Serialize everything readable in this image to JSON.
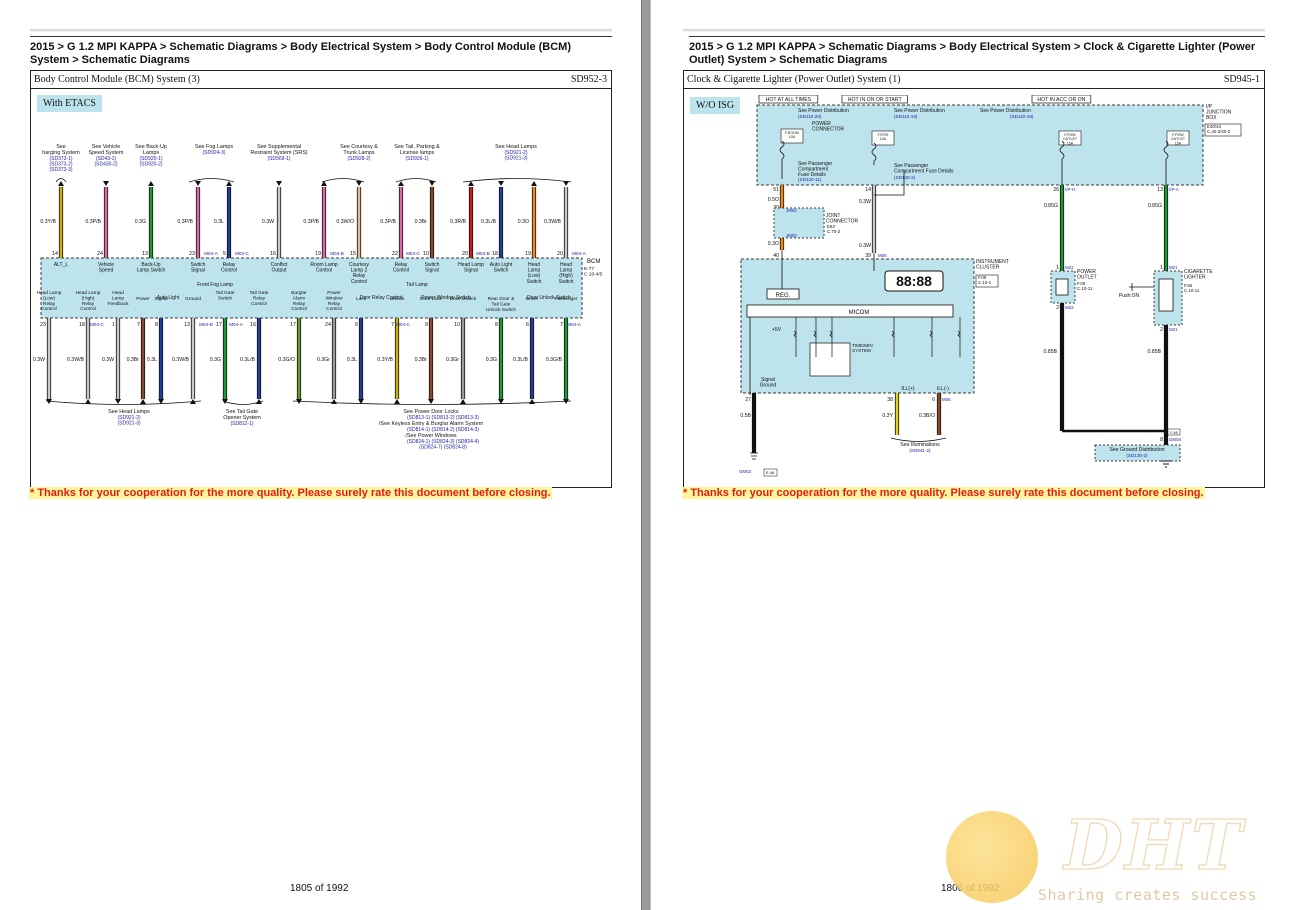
{
  "left_page": {
    "breadcrumb": "2015 > G 1.2 MPI KAPPA > Schematic Diagrams > Body Electrical System > Body Control Module (BCM) System > Schematic Diagrams",
    "sheet_title": "Body Control Module (BCM) System (3)",
    "sheet_code": "SD952-3",
    "variant_label": "With ETACS",
    "notice": "* Thanks for your cooperation for the more quality. Please surely rate this document before closing.",
    "page_number": "1805 of 1992",
    "top_refs": [
      {
        "title": "See\nharging System",
        "codes": "(SD373-1)\n(SD373-2)\n(SD373-3)"
      },
      {
        "title": "See Vehicle\nSpeed System",
        "codes": "(SD43-1)\n(SD430-2)"
      },
      {
        "title": "See Back-Up\nLamps",
        "codes": "(SD920-1)\n(SD920-2)"
      },
      {
        "title": "See Fog Lamps",
        "codes": "(SD924-3)"
      },
      {
        "title": "See Supplemental\nRestraint System (SRS)",
        "codes": "(SD569-1)"
      },
      {
        "title": "See Courtesy &\nTrunk Lamps",
        "codes": "(SD928-2)"
      },
      {
        "title": "See Tail, Parking &\nLicense lamps",
        "codes": "(SD926-1)"
      },
      {
        "title": "See Head Lamps",
        "codes": "(SD921-2)\n(SD921-3)"
      }
    ],
    "top_wires": [
      {
        "gauge": "0.3Y/B",
        "pin": "14",
        "color": "#c8b40a"
      },
      {
        "gauge": "0.3P/B",
        "pin": "24",
        "color": "#d96aa8"
      },
      {
        "gauge": "0.3G",
        "pin": "13",
        "color": "#1f9a3a"
      },
      {
        "gauge": "0.3P/B",
        "pin": "23",
        "color": "#d96aa8"
      },
      {
        "gauge": "0.3L",
        "pin": "5",
        "color": "#1f3f9a"
      },
      {
        "gauge": "0.3W",
        "pin": "16",
        "color": "#c9c9c9"
      },
      {
        "gauge": "0.3P/B",
        "pin": "19",
        "color": "#d96aa8"
      },
      {
        "gauge": "0.3W/O",
        "pin": "15",
        "color": "#e9b894"
      },
      {
        "gauge": "0.3P/B",
        "pin": "22",
        "color": "#d96aa8"
      },
      {
        "gauge": "0.3Br",
        "pin": "10",
        "color": "#8a4a2a"
      },
      {
        "gauge": "0.3R/B",
        "pin": "20",
        "color": "#c71e1e"
      },
      {
        "gauge": "0.3L/B",
        "pin": "18",
        "color": "#1f3f9a"
      },
      {
        "gauge": "0.3O",
        "pin": "19",
        "color": "#ef8b1e"
      },
      {
        "gauge": "0.3W/B",
        "pin": "20",
        "color": "#c9c9c9"
      }
    ],
    "top_connectors": [
      "M04-A",
      "M04-C",
      "M04-B",
      "M04-C",
      "M04-B",
      "M04-A"
    ],
    "bcm_label": "BCM",
    "bcm_ref": "E-77\nC.10-4/5",
    "bcm_top_labels": [
      "ALT_L",
      "Vehicle\nSpeed",
      "Back-Up\nLamp Switch",
      "Switch\nSignal",
      "Relay\nControl",
      "Conflict\nOutput",
      "Room Lamp\nControl",
      "Courtesy\nLamp 2\nRelay\nControl",
      "Relay\nControl",
      "Switch\nSignal",
      "Head Lamp\nSignal",
      "Auto Light\nSwitch",
      "Head\nLamp\n(Low)\nSwitch",
      "Head\nLamp\n(High)\nSwitch"
    ],
    "bcm_group_top": [
      "Front Fog Lamp",
      "Tail Lamp"
    ],
    "bcm_bottom_labels": [
      "Head Lamp\n(Low)\nRelay\nControl",
      "Head Lamp\n(High)\nRelay\nControl",
      "Head\nLamp\nFeedback",
      "Power",
      "Signal",
      "Ground",
      "Tail Gate\nSwitch",
      "Tail Gate\nRelay\nControl",
      "Burglar\nAlarm\nRelay\nControl",
      "Power\nWindow\nRelay\nControl",
      "Lock",
      "Unlock",
      "Door Lock",
      "Door Unlock",
      "Rear Door &\nTail Gate\nUnlock Switch",
      "Driver",
      "Passenger"
    ],
    "bcm_group_bottom": [
      "Auto Light",
      "Door Relay Control",
      "Power Window Switch",
      "Door Unlock Switch"
    ],
    "bottom_wires": [
      {
        "gauge": "0.3W",
        "pin": "23",
        "color": "#c9c9c9"
      },
      {
        "gauge": "0.3W/B",
        "pin": "18",
        "color": "#c9c9c9"
      },
      {
        "gauge": "0.3W",
        "pin": "1",
        "color": "#c9c9c9"
      },
      {
        "gauge": "0.3Br",
        "pin": "7",
        "color": "#8a4a2a"
      },
      {
        "gauge": "0.3L",
        "pin": "8",
        "color": "#1f3f9a"
      },
      {
        "gauge": "0.3W/B",
        "pin": "13",
        "color": "#c9c9c9"
      },
      {
        "gauge": "0.3G",
        "pin": "17",
        "color": "#1f9a3a"
      },
      {
        "gauge": "0.3L/B",
        "pin": "16",
        "color": "#1f3f9a"
      },
      {
        "gauge": "0.3G/O",
        "pin": "17",
        "color": "#6a9a2a"
      },
      {
        "gauge": "0.3Gr",
        "pin": "24",
        "color": "#9a9a9a"
      },
      {
        "gauge": "0.3L",
        "pin": "6",
        "color": "#1f3f9a"
      },
      {
        "gauge": "0.3Y/B",
        "pin": "7",
        "color": "#c8b40a"
      },
      {
        "gauge": "0.3Br",
        "pin": "9",
        "color": "#8a4a2a"
      },
      {
        "gauge": "0.3Gr",
        "pin": "10",
        "color": "#9a9a9a"
      },
      {
        "gauge": "0.3G",
        "pin": "8",
        "color": "#1f9a3a"
      },
      {
        "gauge": "0.3L/B",
        "pin": "6",
        "color": "#1f3f9a"
      },
      {
        "gauge": "0.3G/B",
        "pin": "7",
        "color": "#1f9a3a"
      }
    ],
    "bottom_connectors": [
      "M04-C",
      "M04-B",
      "M04-A",
      "M04-C",
      "M04-A"
    ],
    "bottom_refs": [
      {
        "title": "See Head Lamps",
        "codes": "(SD921-2)\n(SD921-3)"
      },
      {
        "title": "See Tail Gate\nOpener System",
        "codes": "(SD812-1)"
      },
      {
        "title": "See Power Door Locks",
        "codes": "(SD813-1)   (SD813-2)   (SD813-3)"
      },
      {
        "title": "/See Keyless Entry & Burglar Alarm System",
        "codes": "(SD814-1)   (SD814-2)   (SD814-3)"
      },
      {
        "title": "/See Power Windows",
        "codes": "(SD824-1)   (SD824-3)   (SD824-4)\n(SD824-7)   (SD824-8)"
      }
    ]
  },
  "right_page": {
    "breadcrumb": "2015 > G 1.2 MPI KAPPA > Schematic Diagrams > Body Electrical System > Clock & Cigarette Lighter (Power Outlet) System > Schematic Diagrams",
    "sheet_title": "Clock & Cigarette Lighter (Power Outlet) System (1)",
    "sheet_code": "SD945-1",
    "variant_label": "W/O ISG",
    "notice": "* Thanks for your cooperation for the more quality. Please surely rate this document before closing.",
    "page_number": "1806 of 1992",
    "hot_labels": [
      "HOT AT ALL TIMES",
      "HOT IN ON OR START",
      "HOT IN ACC OR ON"
    ],
    "junction_box": {
      "label": "I/P\nJUNCTION\nBOX",
      "ref": "E40/43\nC.40-2/40-2"
    },
    "power_dist_refs": [
      {
        "title": "See Power Distribution",
        "code": "(SD110-20)"
      },
      {
        "title": "See Power Distribution",
        "code": "(SD110-19)"
      },
      {
        "title": "See Power Distribution",
        "code": "(SD110-19)"
      }
    ],
    "power_connector": "POWER\nCONNECTOR",
    "passenger_refs": [
      {
        "title": "See Passenger\nCompartment\nFuse Details",
        "code": "(SD120-11)"
      },
      {
        "title": "See Passenger\nCompartment Fuse Details",
        "code": "(SD120-2)"
      }
    ],
    "fuse_labels": [
      "F.ROOM\n10A",
      "F.RTIS\n10A",
      "F.POW\nOUTLET\n15A"
    ],
    "joint_connector": {
      "label": "JOINT\nCONNECTOR",
      "ref": "E63\nC.70-2"
    },
    "jm_labels": [
      "JM02",
      "JM02"
    ],
    "wires": [
      {
        "pin": "51",
        "gauge": "0.5O",
        "color": "#ef8b1e"
      },
      {
        "pin": "20",
        "gauge": "",
        "color": "#ef8b1e"
      },
      {
        "pin": "19",
        "gauge": "0.3O",
        "color": "#ef8b1e"
      },
      {
        "pin": "40",
        "gauge": "",
        "color": "#ef8b1e"
      },
      {
        "pin": "14",
        "gauge": "0.3W",
        "color": "#c9c9c9"
      },
      {
        "pin": "39",
        "gauge": "0.3W",
        "color": "#c9c9c9"
      },
      {
        "pin": "26",
        "gauge": "0.85G",
        "color": "#1f9a3a"
      },
      {
        "pin": "13",
        "gauge": "0.85G",
        "color": "#1f9a3a"
      },
      {
        "pin": "27",
        "gauge": "0.5B",
        "color": "#111111"
      },
      {
        "pin": "38",
        "gauge": "0.3Y",
        "color": "#e4d21a"
      },
      {
        "pin": "6",
        "gauge": "0.3B/O",
        "color": "#8a4a2a"
      },
      {
        "pin": "2",
        "gauge": "0.85B",
        "color": "#111111"
      },
      {
        "pin": "2",
        "gauge": "0.85B",
        "color": "#111111"
      }
    ],
    "connector_codes": [
      "I/P-H",
      "I/P-A",
      "M06",
      "M06",
      "M22",
      "M22",
      "M21",
      "M21",
      "GM04",
      "GM03"
    ],
    "instrument_cluster": {
      "label": "INSTRUMENT\nCLUSTER",
      "ref": "F.09\nC.10-1"
    },
    "clock_display": "88:88",
    "reg_label": "REG.",
    "micom_label": "MICOM",
    "volt_label": "+5V",
    "time_label": "TIME/MIN\nSYSTEM",
    "signal_ground": "Signal\nGround",
    "ill_labels": [
      "ILL(+)",
      "ILL(-)"
    ],
    "power_outlet": {
      "label": "POWER\nOUTLET",
      "ref": "F.06\nC.10-11"
    },
    "cigarette_lighter": {
      "label": "CIGARETTE\nLIGHTER",
      "ref": "F.56\nC.10-11"
    },
    "push_on": "Push:ON",
    "illum_ref": {
      "title": "See Illuminations",
      "code": "(SD941-2)"
    },
    "ground_ref": {
      "title": "See Ground Distribution",
      "code": "(SD130-2)"
    },
    "ground_codes": [
      "E.48",
      "F.48"
    ]
  },
  "watermark": {
    "brand": "DHT",
    "tagline": "Sharing creates success"
  }
}
